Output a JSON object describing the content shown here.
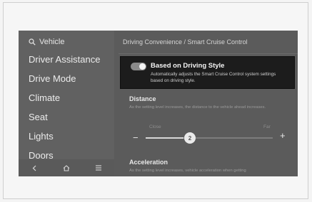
{
  "search": {
    "label": "Vehicle"
  },
  "sidebar": {
    "items": [
      {
        "label": "Driver Assistance"
      },
      {
        "label": "Drive Mode"
      },
      {
        "label": "Climate"
      },
      {
        "label": "Seat"
      },
      {
        "label": "Lights"
      },
      {
        "label": "Doors"
      }
    ]
  },
  "breadcrumb": {
    "text": "Driving Convenience  /  Smart Cruise Control"
  },
  "driving_style": {
    "label": "Based on Driving Style",
    "description": "Automatically adjusts the Smart Cruise Control system settings based on driving style.",
    "enabled": true
  },
  "distance": {
    "title": "Distance",
    "description": "As the setting level increases, the distance to the vehicle ahead increases.",
    "min_label": "Close",
    "max_label": "Far",
    "value": "2",
    "level_fraction": 0.3
  },
  "acceleration": {
    "title": "Acceleration",
    "description": "As the setting level increases, vehicle acceleration when getting"
  },
  "colors": {
    "screen_bg": "#5b5b5b",
    "highlight_bg": "#1c1c1c"
  }
}
